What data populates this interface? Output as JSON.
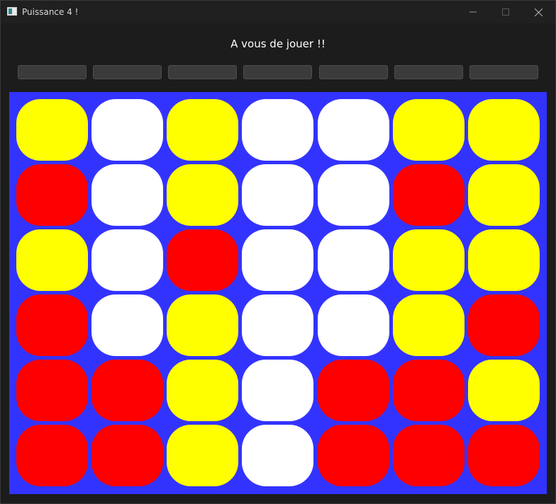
{
  "window": {
    "title": "Puissance 4 !",
    "icon": "window-app-icon"
  },
  "status_text": "A vous de jouer !!",
  "column_buttons": [
    {
      "label": ""
    },
    {
      "label": ""
    },
    {
      "label": ""
    },
    {
      "label": ""
    },
    {
      "label": ""
    },
    {
      "label": ""
    },
    {
      "label": ""
    }
  ],
  "colors": {
    "board": "#3333ff",
    "yellow": "#ffff00",
    "red": "#ff0000",
    "empty": "#ffffff"
  },
  "board": {
    "rows": 6,
    "columns": 7,
    "cells": [
      [
        "yellow",
        "empty",
        "yellow",
        "empty",
        "empty",
        "yellow",
        "yellow"
      ],
      [
        "red",
        "empty",
        "yellow",
        "empty",
        "empty",
        "red",
        "yellow"
      ],
      [
        "yellow",
        "empty",
        "red",
        "empty",
        "empty",
        "yellow",
        "yellow"
      ],
      [
        "red",
        "empty",
        "yellow",
        "empty",
        "empty",
        "yellow",
        "red"
      ],
      [
        "red",
        "red",
        "yellow",
        "empty",
        "red",
        "red",
        "yellow"
      ],
      [
        "red",
        "red",
        "yellow",
        "empty",
        "red",
        "red",
        "red"
      ]
    ]
  }
}
